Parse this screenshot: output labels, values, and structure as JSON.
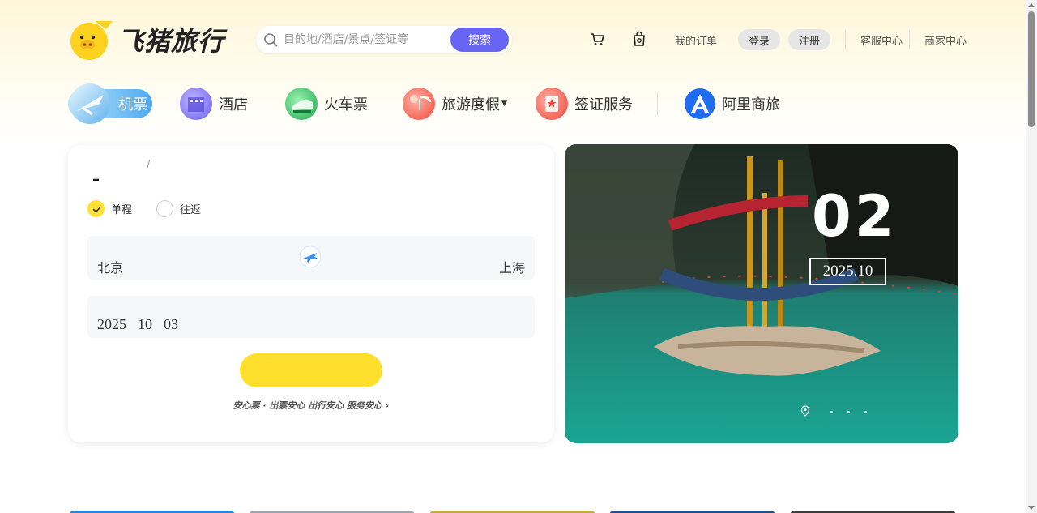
{
  "header": {
    "logo_text": "飞猪旅行",
    "search": {
      "placeholder": "目的地/酒店/景点/签证等",
      "button": "搜索"
    },
    "links": [
      "我的订单",
      "登录",
      "注册",
      "客服中心",
      "商家中心"
    ],
    "icons": [
      "cart-icon",
      "bag-icon"
    ]
  },
  "nav": {
    "items": [
      {
        "label": "机票",
        "icon": "plane-icon",
        "active": true
      },
      {
        "label": "酒店",
        "icon": "hotel-icon"
      },
      {
        "label": "火车票",
        "icon": "train-icon"
      },
      {
        "label": "旅游度假",
        "icon": "vacation-icon",
        "has_dropdown": true
      },
      {
        "label": "签证服务",
        "icon": "visa-icon"
      },
      {
        "label": "阿里商旅",
        "icon": "business-travel-icon"
      }
    ]
  },
  "booking": {
    "title_dash": "–",
    "title_slash": "/",
    "trip_types": [
      {
        "label": "单程",
        "checked": true
      },
      {
        "label": "往返",
        "checked": false
      }
    ],
    "from_city": "北京",
    "to_city": "上海",
    "date": {
      "year": "2025",
      "month": "10",
      "day": "03"
    },
    "trust_text": "安心票 · 出票安心 出行安心 服务安心 ›"
  },
  "banner": {
    "day": "02",
    "month": "2025.10",
    "dots": 3
  },
  "colors": {
    "accent": "#6865f5",
    "brand_yellow": "#ffdf2e",
    "active_nav": "#4fa9ee"
  }
}
